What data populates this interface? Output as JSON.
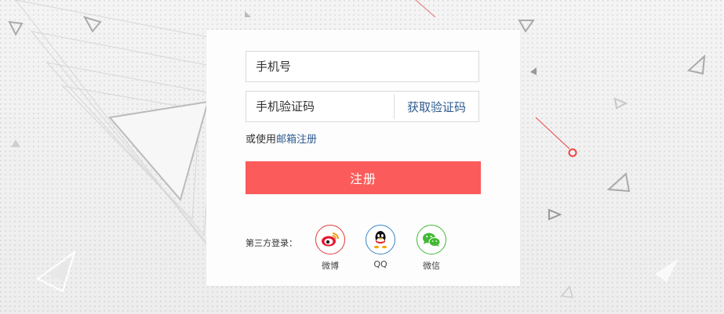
{
  "form": {
    "phone_placeholder": "手机号",
    "code_placeholder": "手机验证码",
    "get_code_label": "获取验证码",
    "alt_prefix": "或使用",
    "alt_link": "邮箱注册",
    "submit_label": "注册"
  },
  "third_party": {
    "label": "第三方登录：",
    "providers": [
      {
        "name": "微博",
        "icon": "weibo-icon",
        "color": "#e03c3c"
      },
      {
        "name": "QQ",
        "icon": "qq-icon",
        "color": "#3a86c7"
      },
      {
        "name": "微信",
        "icon": "wechat-icon",
        "color": "#42b934"
      }
    ]
  },
  "colors": {
    "accent": "#fb5b5a",
    "link": "#2f5b8f"
  }
}
